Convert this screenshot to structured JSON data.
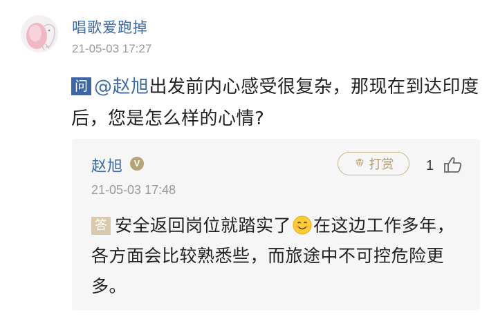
{
  "post": {
    "username": "唱歌爱跑掉",
    "timestamp": "21-05-03 17:27",
    "question_badge": "问",
    "mention": "@赵旭",
    "question_text": "出发前内心感受很复杂，那现在到达印度后，您是怎么样的心情?"
  },
  "reply": {
    "name": "赵旭",
    "verified_badge": "V",
    "reward_label": "打赏",
    "like_count": "1",
    "timestamp": "21-05-03 17:48",
    "answer_badge": "答",
    "answer_part1": "安全返回岗位就踏实了",
    "answer_part2": "在这边工作多年，各方面会比较熟悉些，而旅途中不可控危险更多。"
  },
  "icons": {
    "avatar": "cartoon-avatar",
    "reward": "diamond-icon",
    "like": "thumbs-up-icon",
    "emoji": "smile-emoji-icon"
  },
  "colors": {
    "link_blue": "#3b6aa6",
    "question_badge": "#3d66a8",
    "answer_badge": "#d9c9aa",
    "reward_gold": "#b39c6f",
    "reply_bg": "#f6f6f6"
  }
}
